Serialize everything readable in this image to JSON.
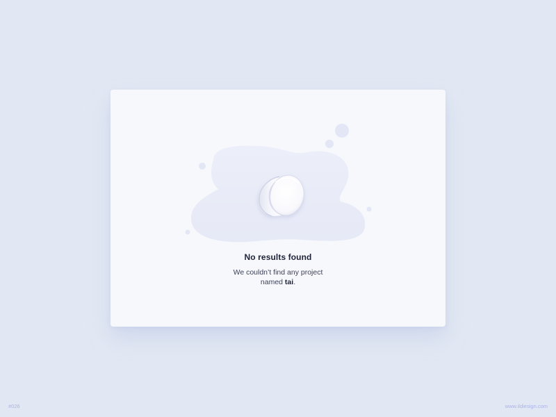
{
  "empty_state": {
    "title": "No results found",
    "message_line1": "We couldn’t find any project",
    "message_prefix": "named ",
    "query": "tai",
    "message_suffix": ".",
    "illustration_icon": "spilled-cup-icon"
  },
  "footer": {
    "shot_number": "#026",
    "website": "www.ildiesign.com"
  },
  "colors": {
    "background": "#e2e8f3",
    "card": "#f7f8fc",
    "puddle": "#e9ecf7",
    "title_text": "#1f2338",
    "body_text": "#3d4157",
    "footer_text": "#aab3e6"
  }
}
